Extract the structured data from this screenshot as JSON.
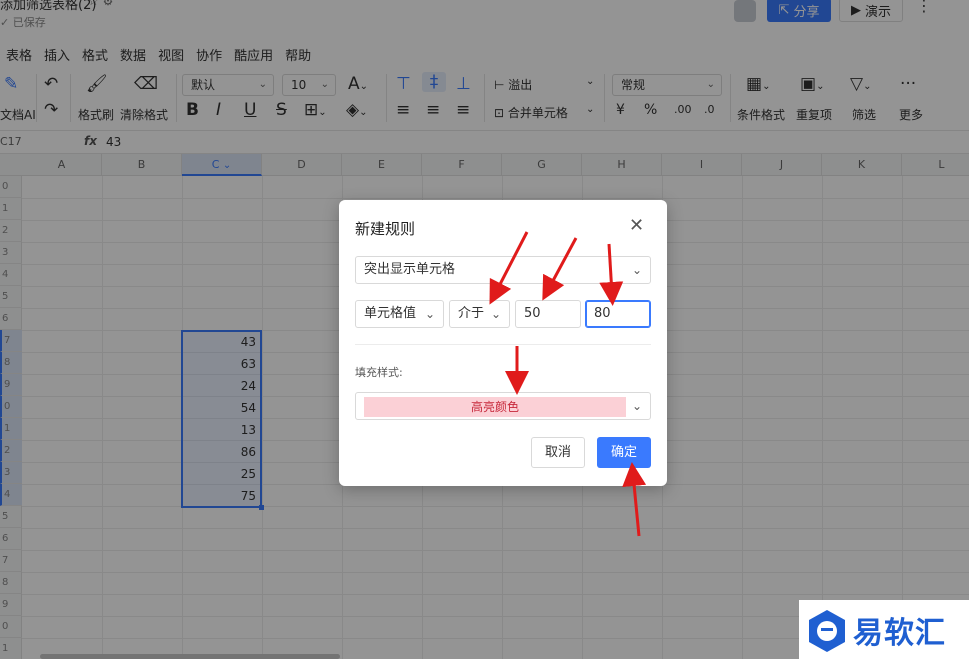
{
  "app": {
    "doc_title": "添加筛选表格(2)",
    "saved_status": "已保存",
    "share_label": "分享",
    "present_label": "演示"
  },
  "menu": [
    "表格",
    "插入",
    "格式",
    "数据",
    "视图",
    "协作",
    "酷应用",
    "帮助"
  ],
  "toolbar": {
    "ai_label": "文档AI",
    "format_painter": "格式刷",
    "clear_format": "清除格式",
    "font_name": "默认",
    "font_size": "10",
    "overflow": "溢出",
    "merge_cells": "合并单元格",
    "number_format": "常规",
    "conditional_format": "条件格式",
    "duplicates": "重复项",
    "filter": "筛选",
    "more": "更多"
  },
  "formula_bar": {
    "cell_ref": "C17",
    "fx": "fx",
    "value": "43"
  },
  "grid": {
    "columns": [
      "A",
      "B",
      "C",
      "D",
      "E",
      "F",
      "G",
      "H",
      "I",
      "J",
      "K",
      "L"
    ],
    "active_column": "C",
    "row_labels": [
      "0",
      "1",
      "2",
      "3",
      "4",
      "5",
      "6",
      "7",
      "8",
      "9",
      "0",
      "1",
      "2",
      "3",
      "4",
      "5",
      "6",
      "7",
      "8",
      "9",
      "0",
      "1"
    ],
    "selected_values": [
      "43",
      "63",
      "24",
      "54",
      "13",
      "86",
      "25",
      "75"
    ]
  },
  "dialog": {
    "title": "新建规则",
    "rule_type": "突出显示单元格",
    "condition_field": "单元格值",
    "operator": "介于",
    "value_min": "50",
    "value_max": "80",
    "fill_style_label": "填充样式:",
    "fill_style_value": "高亮颜色",
    "cancel": "取消",
    "ok": "确定"
  },
  "watermark": {
    "text": "易软汇"
  },
  "colors": {
    "accent": "#3a7afe",
    "highlight_fill": "#fbd0d6",
    "highlight_text": "#c7283b",
    "arrow": "#e01b1b"
  }
}
